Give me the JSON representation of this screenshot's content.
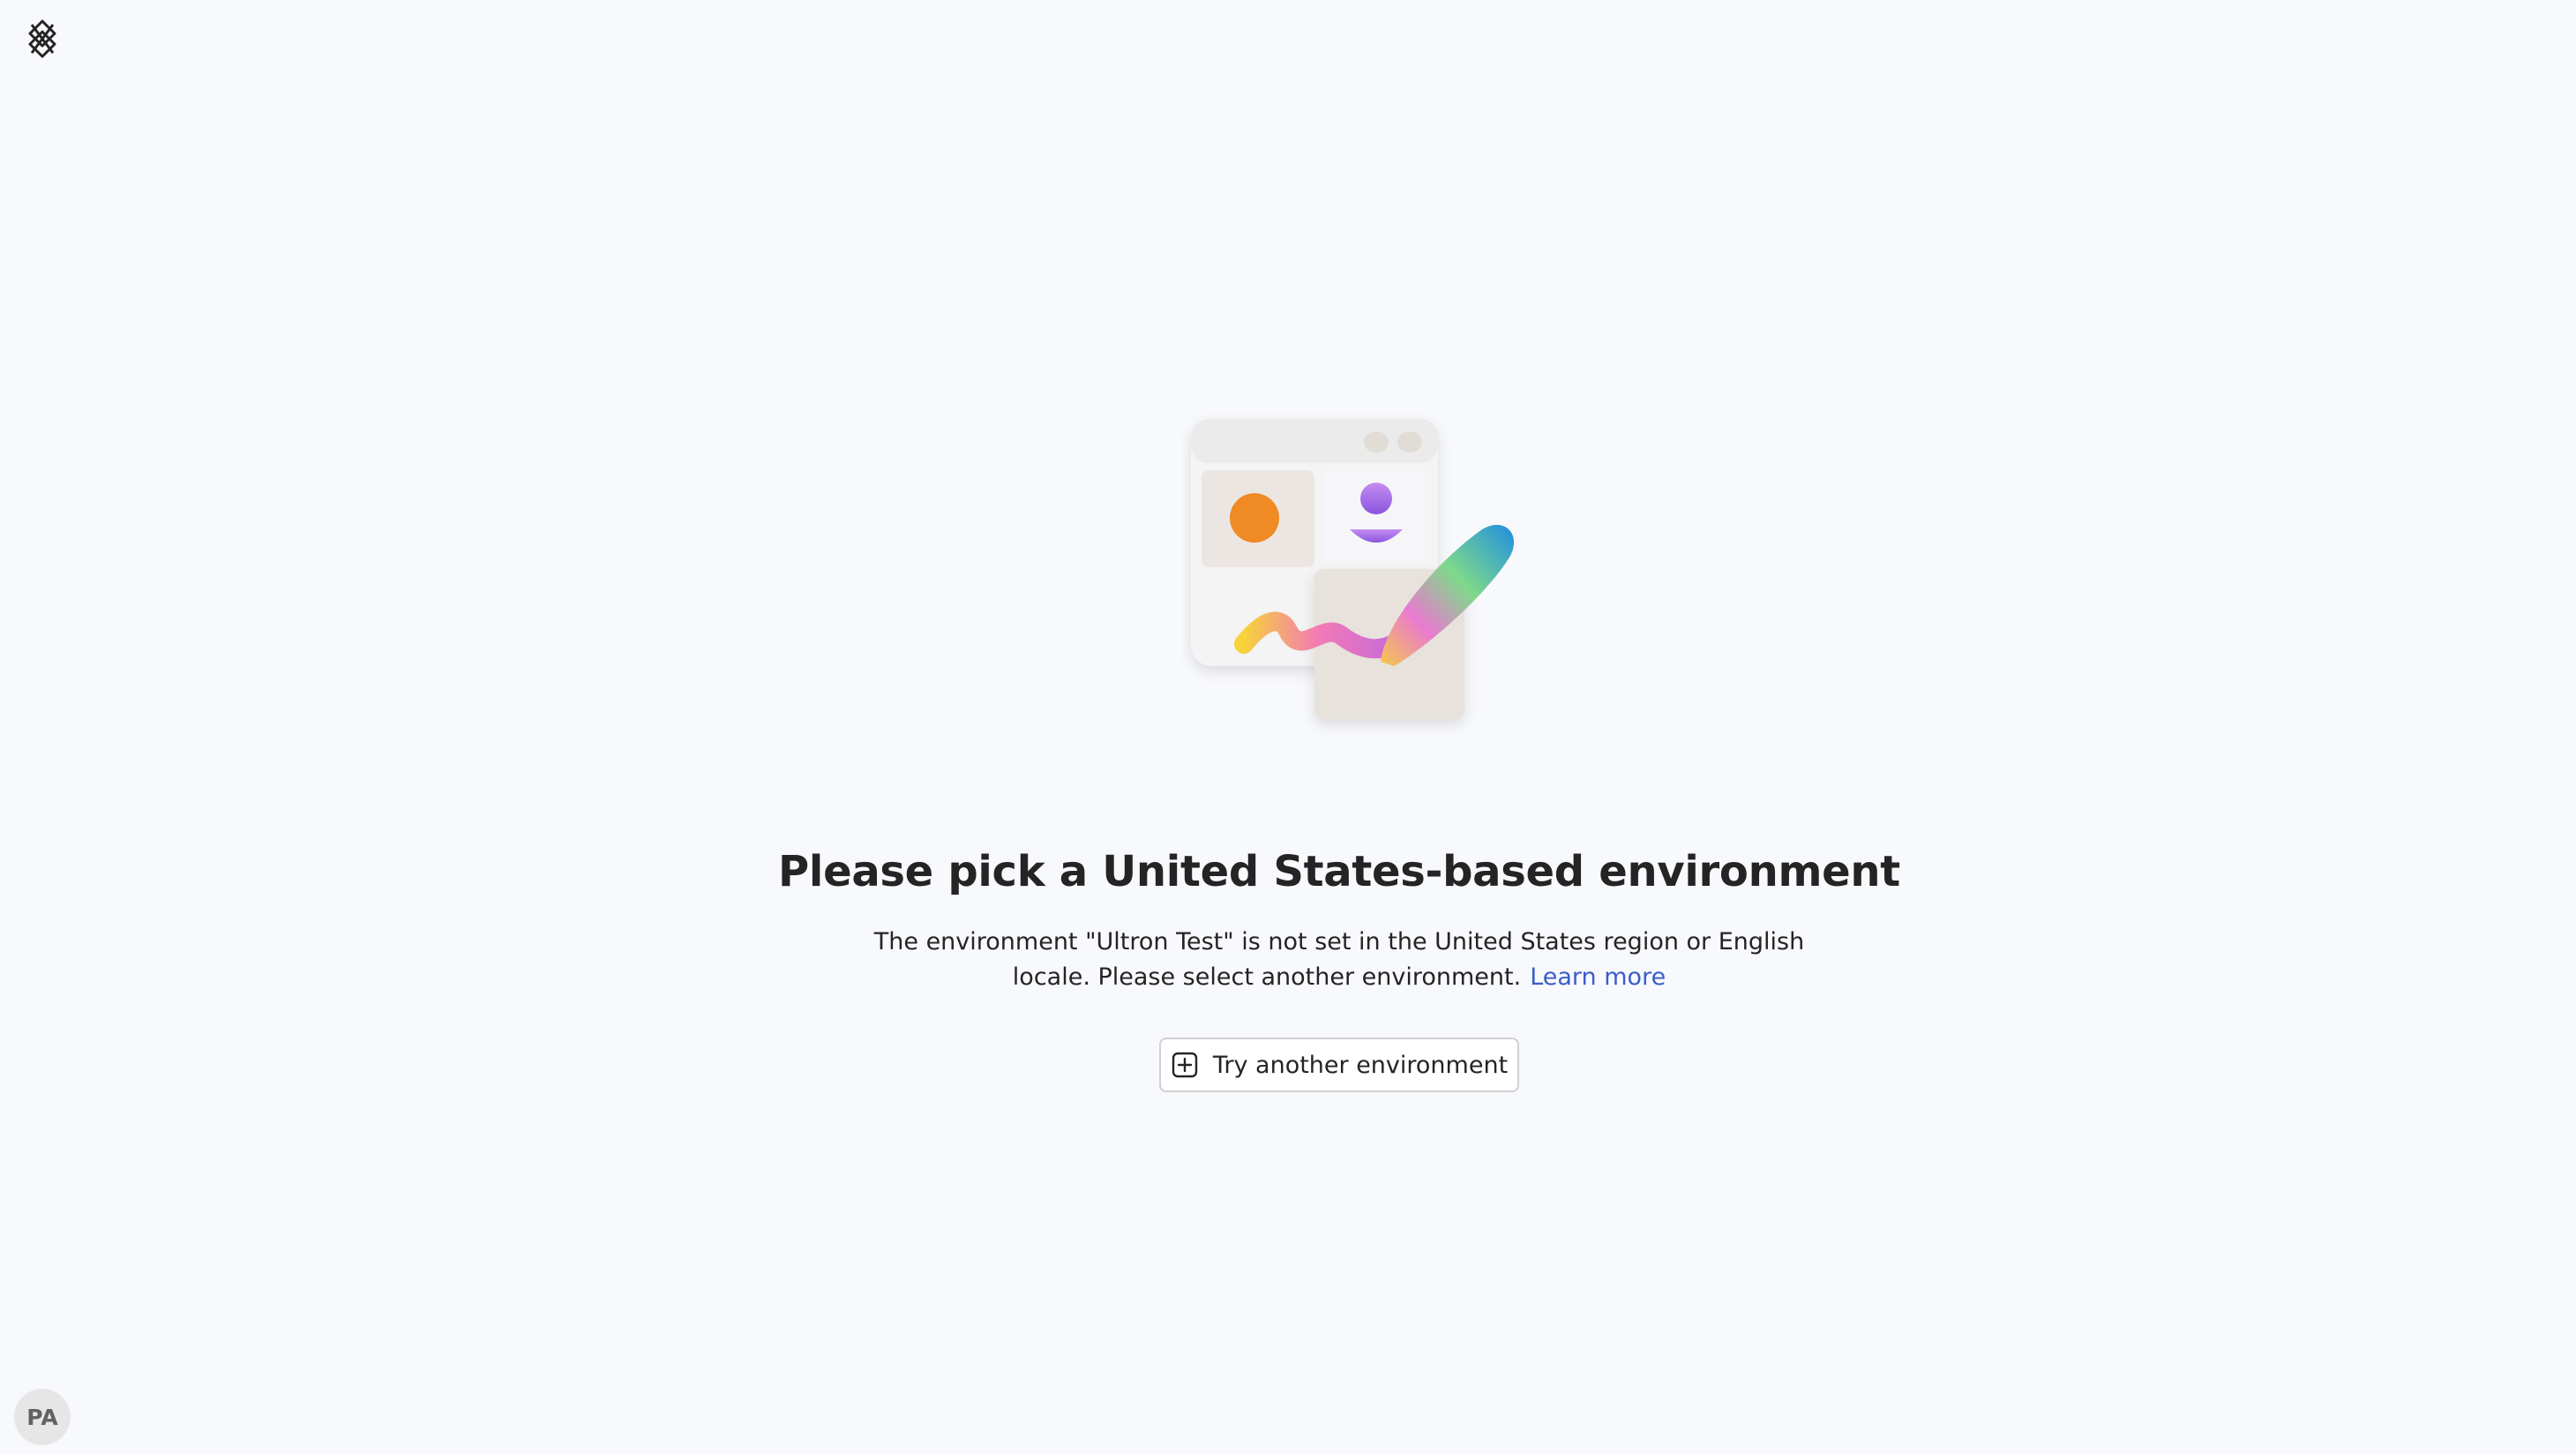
{
  "app": {
    "logo_icon": "power-apps-logo-icon"
  },
  "main": {
    "illustration": "environment-illustration",
    "headline": "Please pick a United States-based environment",
    "message": "The environment \"Ultron Test\" is not set in the United States region or English locale. Please select another environment.",
    "learn_more": "Learn more",
    "try_button": {
      "label": "Try another environment",
      "icon": "add-square-icon"
    }
  },
  "user": {
    "initials": "PA"
  },
  "colors": {
    "background": "#f8f9fc",
    "link": "#3b5cc9",
    "text": "#242424",
    "button_border": "#d1d1d1",
    "avatar_bg": "#e6e6e6"
  }
}
